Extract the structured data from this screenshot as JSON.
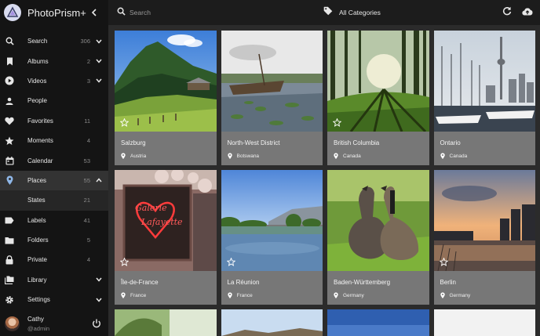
{
  "app": {
    "title": "PhotoPrism+"
  },
  "sidebar": {
    "items": [
      {
        "label": "Search",
        "count": "306",
        "icon": "search-icon",
        "chevron": true
      },
      {
        "label": "Albums",
        "count": "2",
        "icon": "bookmark-icon",
        "chevron": true
      },
      {
        "label": "Videos",
        "count": "3",
        "icon": "play-circle-icon",
        "chevron": true
      },
      {
        "label": "People",
        "count": "",
        "icon": "person-icon",
        "chevron": false
      },
      {
        "label": "Favorites",
        "count": "11",
        "icon": "heart-icon",
        "chevron": false
      },
      {
        "label": "Moments",
        "count": "4",
        "icon": "star-icon",
        "chevron": false
      },
      {
        "label": "Calendar",
        "count": "53",
        "icon": "calendar-icon",
        "chevron": false
      },
      {
        "label": "Places",
        "count": "55",
        "icon": "map-pin-icon",
        "chevron": "up",
        "active": true
      },
      {
        "label": "States",
        "count": "21",
        "sub": true
      },
      {
        "label": "Labels",
        "count": "41",
        "icon": "label-icon",
        "chevron": false
      },
      {
        "label": "Folders",
        "count": "5",
        "icon": "folder-icon",
        "chevron": false
      },
      {
        "label": "Private",
        "count": "4",
        "icon": "lock-icon",
        "chevron": false
      },
      {
        "label": "Library",
        "count": "",
        "icon": "library-icon",
        "chevron": true
      },
      {
        "label": "Settings",
        "count": "",
        "icon": "gear-icon",
        "chevron": true
      }
    ],
    "user": {
      "name": "Cathy",
      "handle": "@admin"
    }
  },
  "toolbar": {
    "search_placeholder": "Search",
    "category": "All Categories"
  },
  "places": [
    {
      "title": "Salzburg",
      "country": "Austria"
    },
    {
      "title": "North-West District",
      "country": "Botswana"
    },
    {
      "title": "British Columbia",
      "country": "Canada"
    },
    {
      "title": "Ontario",
      "country": "Canada"
    },
    {
      "title": "Île-de-France",
      "country": "France"
    },
    {
      "title": "La Réunion",
      "country": "France"
    },
    {
      "title": "Baden-Württemberg",
      "country": "Germany"
    },
    {
      "title": "Berlin",
      "country": "Germany"
    }
  ],
  "colors": {
    "sidebar_bg": "#141414",
    "toolbar_bg": "#1c1c1c",
    "content_bg": "#2b2b2b",
    "card_bg": "#777777",
    "active_item_bg": "#333333"
  }
}
